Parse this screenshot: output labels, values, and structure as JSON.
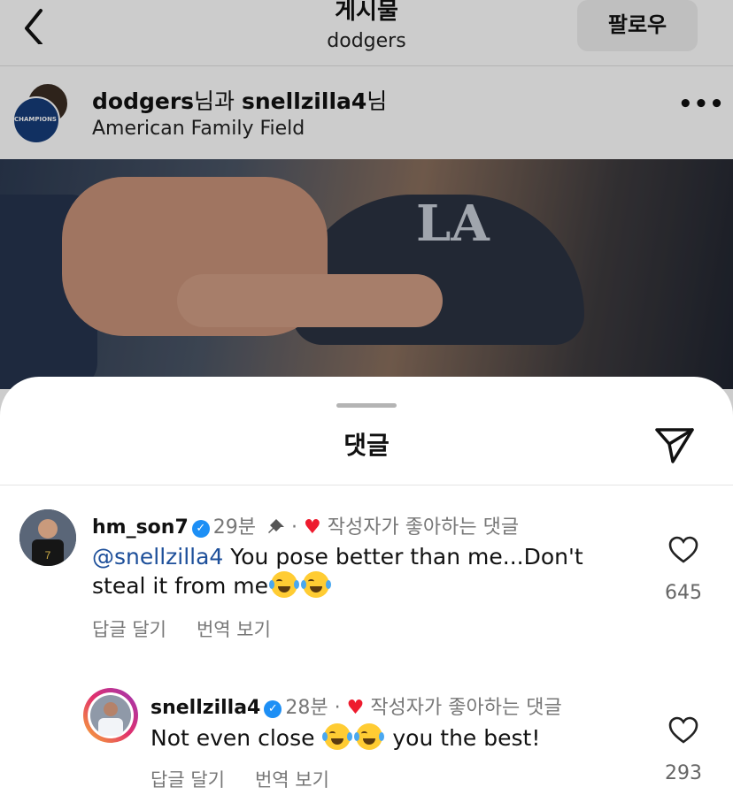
{
  "topbar": {
    "title": "게시물",
    "subtitle": "dodgers",
    "follow_label": "팔로우"
  },
  "post_header": {
    "user1": "dodgers",
    "connector": "님과 ",
    "user2": "snellzilla4",
    "suffix": "님",
    "location": "American Family Field",
    "more": "•••",
    "badge_text": "CHAMPIONS"
  },
  "sheet": {
    "title": "댓글"
  },
  "comments": [
    {
      "username": "hm_son7",
      "time": "29분",
      "pinned": true,
      "separator": "·",
      "liked_by_author": "작성자가 좋아하는 댓글",
      "mention": "@snellzilla4",
      "text_line1": " You pose better than me...Don't",
      "text_line2": "steal it from me",
      "reply_label": "답글 달기",
      "translate_label": "번역 보기",
      "likes": "645",
      "jersey_number": "7"
    },
    {
      "username": "snellzilla4",
      "time": "28분",
      "separator": "·",
      "liked_by_author": "작성자가 좋아하는 댓글",
      "text_before": "Not even close ",
      "text_after": " you the best!",
      "reply_label": "답글 달기",
      "translate_label": "번역 보기",
      "likes": "293"
    }
  ],
  "colors": {
    "verified": "#1d8ff5",
    "heart": "#ee1b2e",
    "mention": "#1d4f9a"
  },
  "icons": [
    "back-chevron-icon",
    "more-icon",
    "send-icon",
    "verified-icon",
    "pin-icon",
    "heart-icon",
    "like-heart-icon",
    "laughing-tears-emoji"
  ]
}
